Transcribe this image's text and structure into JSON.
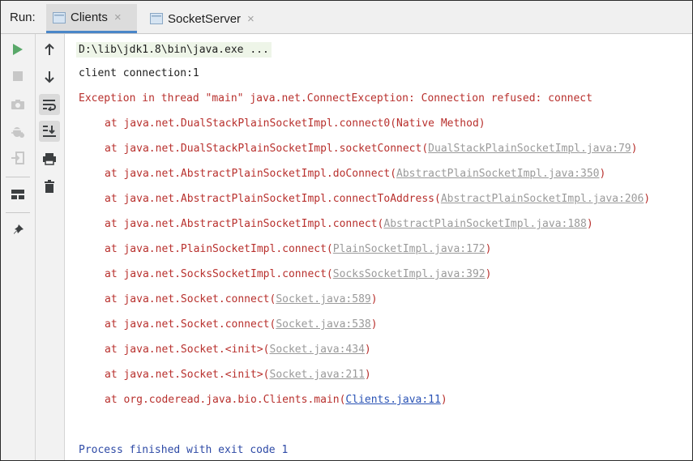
{
  "header": {
    "run_label": "Run:",
    "tabs": [
      {
        "label": "Clients",
        "close": "×"
      },
      {
        "label": "SocketServer",
        "close": "×"
      }
    ]
  },
  "left_toolbar": [
    {
      "icon": "play-icon",
      "color": "#59a869"
    },
    {
      "icon": "stop-icon"
    },
    {
      "icon": "camera-icon"
    },
    {
      "icon": "bug-icon"
    },
    {
      "icon": "login-icon"
    },
    {
      "icon": "layout-icon"
    },
    {
      "icon": "pin-icon"
    }
  ],
  "right_toolbar": [
    {
      "icon": "arrow-up-icon"
    },
    {
      "icon": "arrow-down-icon"
    },
    {
      "icon": "soft-wrap-icon",
      "pressed": true
    },
    {
      "icon": "scroll-to-end-icon",
      "pressed": true
    },
    {
      "icon": "print-icon"
    },
    {
      "icon": "trash-icon"
    }
  ],
  "console": {
    "command": "D:\\lib\\jdk1.8\\bin\\java.exe ...",
    "client_line": "client connection:1",
    "exception": "Exception in thread \"main\" java.net.ConnectException: Connection refused: connect",
    "frames": [
      {
        "prefix": "at java.net.DualStackPlainSocketImpl.connect0(",
        "link": "",
        "suffix": "Native Method)"
      },
      {
        "prefix": "at java.net.DualStackPlainSocketImpl.socketConnect(",
        "link": "DualStackPlainSocketImpl.java:79",
        "suffix": ")"
      },
      {
        "prefix": "at java.net.AbstractPlainSocketImpl.doConnect(",
        "link": "AbstractPlainSocketImpl.java:350",
        "suffix": ")"
      },
      {
        "prefix": "at java.net.AbstractPlainSocketImpl.connectToAddress(",
        "link": "AbstractPlainSocketImpl.java:206",
        "suffix": ")"
      },
      {
        "prefix": "at java.net.AbstractPlainSocketImpl.connect(",
        "link": "AbstractPlainSocketImpl.java:188",
        "suffix": ")"
      },
      {
        "prefix": "at java.net.PlainSocketImpl.connect(",
        "link": "PlainSocketImpl.java:172",
        "suffix": ")"
      },
      {
        "prefix": "at java.net.SocksSocketImpl.connect(",
        "link": "SocksSocketImpl.java:392",
        "suffix": ")"
      },
      {
        "prefix": "at java.net.Socket.connect(",
        "link": "Socket.java:589",
        "suffix": ")"
      },
      {
        "prefix": "at java.net.Socket.connect(",
        "link": "Socket.java:538",
        "suffix": ")"
      },
      {
        "prefix": "at java.net.Socket.<init>(",
        "link": "Socket.java:434",
        "suffix": ")"
      },
      {
        "prefix": "at java.net.Socket.<init>(",
        "link": "Socket.java:211",
        "suffix": ")"
      },
      {
        "prefix": "at org.coderead.java.bio.Clients.main(",
        "link": "Clients.java:11",
        "suffix": ")",
        "user_code": true
      }
    ],
    "finished": "Process finished with exit code 1"
  },
  "colors": {
    "error": "#b8302d",
    "library_link": "#9a9a9a",
    "user_link": "#2a53b5",
    "process_finished": "#2e4aa6",
    "run_green": "#59a869"
  }
}
